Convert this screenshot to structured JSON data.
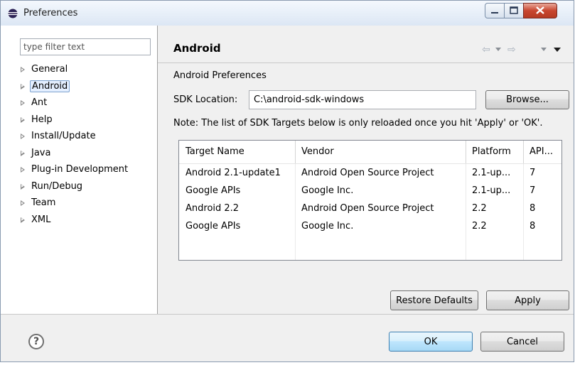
{
  "window": {
    "title": "Preferences"
  },
  "filter": {
    "placeholder": "type filter text"
  },
  "tree": {
    "items": [
      {
        "label": "General"
      },
      {
        "label": "Android"
      },
      {
        "label": "Ant"
      },
      {
        "label": "Help"
      },
      {
        "label": "Install/Update"
      },
      {
        "label": "Java"
      },
      {
        "label": "Plug-in Development"
      },
      {
        "label": "Run/Debug"
      },
      {
        "label": "Team"
      },
      {
        "label": "XML"
      }
    ],
    "selected": "Android"
  },
  "page": {
    "title": "Android",
    "section_label": "Android Preferences",
    "sdk_label": "SDK Location:",
    "sdk_value": "C:\\android-sdk-windows",
    "browse_label": "Browse...",
    "note": "Note: The list of SDK Targets below is only reloaded once you hit 'Apply' or 'OK'."
  },
  "targets": {
    "columns": [
      "Target Name",
      "Vendor",
      "Platform",
      "API..."
    ],
    "rows": [
      [
        "Android 2.1-update1",
        "Android Open Source Project",
        "2.1-up...",
        "7"
      ],
      [
        "Google APIs",
        "Google Inc.",
        "2.1-up...",
        "7"
      ],
      [
        "Android 2.2",
        "Android Open Source Project",
        "2.2",
        "8"
      ],
      [
        "Google APIs",
        "Google Inc.",
        "2.2",
        "8"
      ]
    ]
  },
  "buttons": {
    "restore": "Restore Defaults",
    "apply": "Apply",
    "ok": "OK",
    "cancel": "Cancel"
  },
  "icons": {
    "help": "?",
    "back": "⇦",
    "forward": "⇨"
  }
}
